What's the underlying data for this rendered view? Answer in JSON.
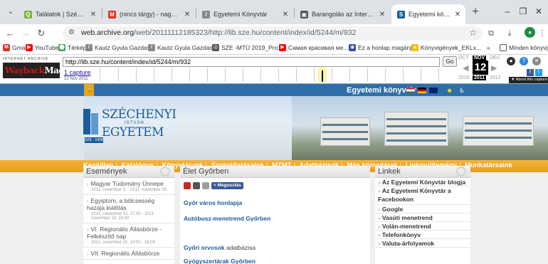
{
  "browser": {
    "tabs": [
      {
        "label": "Találatok | Széchenyi István",
        "favicon": "search-favicon",
        "color": "#7cb342"
      },
      {
        "label": "(nincs tárgy) - nagy.maria@",
        "favicon": "gmail-favicon",
        "color": "#d93025"
      },
      {
        "label": "Egyetemi Könyvtár",
        "favicon": "sze-favicon",
        "color": "#888888"
      },
      {
        "label": "Barangolás az Internet Arch",
        "favicon": "archive-favicon",
        "color": "#555555"
      },
      {
        "label": "Egyetemi könyvtár - Élet Gy",
        "favicon": "sze-favicon",
        "color": "#1c5c9a",
        "active": true
      }
    ],
    "new_tab_label": "+",
    "url_host": "web.archive.org",
    "url_path": "/web/20111112185323/http://lib.sze.hu/content/index/id/5244/m/932",
    "bookmarks": [
      {
        "label": "Gmail",
        "icon": "gmail-icon",
        "color": "#d93025"
      },
      {
        "label": "YouTube",
        "icon": "youtube-icon",
        "color": "#ff0000"
      },
      {
        "label": "Térkép",
        "icon": "maps-icon",
        "color": "#34a853"
      },
      {
        "label": "Kautz Gyula Gazdas...",
        "icon": "sze-icon",
        "color": "#888888"
      },
      {
        "label": "Kautz Gyula Gazdas...",
        "icon": "sze-icon",
        "color": "#888888"
      },
      {
        "label": "SZE -MTÜ 2019_Pro...",
        "icon": "globe-icon",
        "color": "#555555"
      },
      {
        "label": "Самая красивая ме...",
        "icon": "youtube-icon",
        "color": "#ff0000"
      },
      {
        "label": "Ez a honlap magánj...",
        "icon": "web-icon",
        "color": "#3949ab"
      },
      {
        "label": "Könyvigények_EKLx...",
        "icon": "drive-icon",
        "color": "#fbbc04"
      }
    ],
    "bookmarks_overflow": "»",
    "bookmarks_folder": "Minden könyvjelző"
  },
  "wayback": {
    "logo_small": "INTERNET ARCHIVE",
    "logo_big_prefix": "Wayback",
    "logo_big_suffix": "Machine",
    "url_value": "http://lib.sze.hu/content/index/id/5244/m/932",
    "go_label": "Go",
    "captures_label": "1 capture",
    "capture_date": "12 Nov 2011",
    "months": {
      "prev": "OCT",
      "current": "NOV",
      "next": "DEC"
    },
    "day": "12",
    "years": {
      "prev": "2010",
      "current": "2011",
      "next": "2012"
    },
    "about_label": "▼ About this capture"
  },
  "site": {
    "library_title": "Egyetemi könyvtár",
    "logo": {
      "line1": "SZÉCHENYI",
      "line2": "ISTVÁN",
      "line3": "EGYETEM",
      "badge": "SZE · 1968"
    },
    "nav": [
      "Kezdőlap",
      "Katalógus",
      "Könyvtárunk",
      "Szolgáltatásaink",
      "MTMT",
      "Adatbázisok",
      "Más könyvtárak",
      "Linkgyűjtemény",
      "Munkatársaink"
    ],
    "events": {
      "title": "Események",
      "items": [
        {
          "title": "Magyar Tudomány Ünnepe",
          "date": "2011. november 3. - 2011. november 30."
        },
        {
          "title": "Egyiptom, a bölcsesség hazája kiállítás",
          "date": "2011. november 10. 17:00 - 2011. november 23. 19:00"
        },
        {
          "title": "VI. Regionális Állásbörze - Felkészítő nap",
          "date": "2011. november 21. 14:00 - 16:00"
        },
        {
          "title": "VII. Regionális Állásbörze",
          "date": ""
        }
      ]
    },
    "gyor": {
      "title": "Élet Győrben",
      "share_label": "Megosztás",
      "links": [
        {
          "title": "Győr város honlapja",
          "suffix": ""
        },
        {
          "title": "Autóbusz-menetrend Győrben",
          "suffix": ""
        },
        {
          "title": "Győri orvosok",
          "suffix": " adatbázisa"
        },
        {
          "title": "Gyógyszertárak Győrben",
          "suffix": ""
        }
      ]
    },
    "links": {
      "title": "Linkek",
      "items": [
        "Az Egyetemi Könyvtár blogja",
        "Az Egyetemi Könyvtár a Facebookon",
        "Google",
        "Vasúti menetrend",
        "Volán-menetrend",
        "Telefonkönyv",
        "Valuta-árfolyamok"
      ]
    }
  }
}
